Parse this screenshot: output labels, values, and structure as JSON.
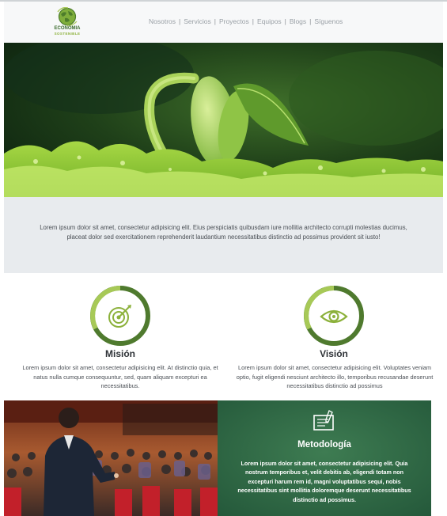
{
  "header": {
    "logo_title": "ECONOMIA SOSTENIBLE",
    "logo_line1": "ECONOMIA",
    "logo_line2": "SOSTENIBLE",
    "nav": [
      "Nosotros",
      "Servicios",
      "Proyectos",
      "Equipos",
      "Blogs",
      "Síguenos"
    ],
    "separator": "|"
  },
  "hero": {
    "image": "sprouting-seedling-photo"
  },
  "intro": {
    "text": "Lorem ipsum dolor sit amet, consectetur adipisicing elit. Eius perspiciatis quibusdam iure mollitia architecto corrupti molestias ducimus, placeat dolor sed exercitationem reprehenderit laudantium necessitatibus distinctio ad possimus provident sit iusto!"
  },
  "cards": [
    {
      "title": "Misión",
      "icon": "target-icon",
      "text": "Lorem ipsum dolor sit amet, consectetur adipisicing elit. At distinctio quia, et natus nulla cumque consequuntur, sed, quam aliquam excepturi ea necessitatibus."
    },
    {
      "title": "Visión",
      "icon": "eye-icon",
      "text": "Lorem ipsum dolor sit amet, consectetur adipisicing elit. Voluptates veniam optio, fugit eligendi nesciunt architecto illo, temporibus recusandae deserunt necessitatibus distinctio ad possimus"
    }
  ],
  "methodology": {
    "title": "Metodología",
    "icon": "chalkboard-icon",
    "text": "Lorem ipsum dolor sit amet, consectetur adipisicing elit. Quia nostrum temporibus et, velit debitis ab, eligendi totam non excepturi harum rem id, magni voluptatibus sequi, nobis necessitatibus sint mollitia doloremque deserunt necessitatibus distinctio ad possimus.",
    "photo": "conference-speaker-photo"
  },
  "colors": {
    "accent_green": "#8cb13b",
    "dark_green": "#4f7a2e",
    "chalkboard": "#2f6b45",
    "intro_bg": "#e8ebee"
  }
}
